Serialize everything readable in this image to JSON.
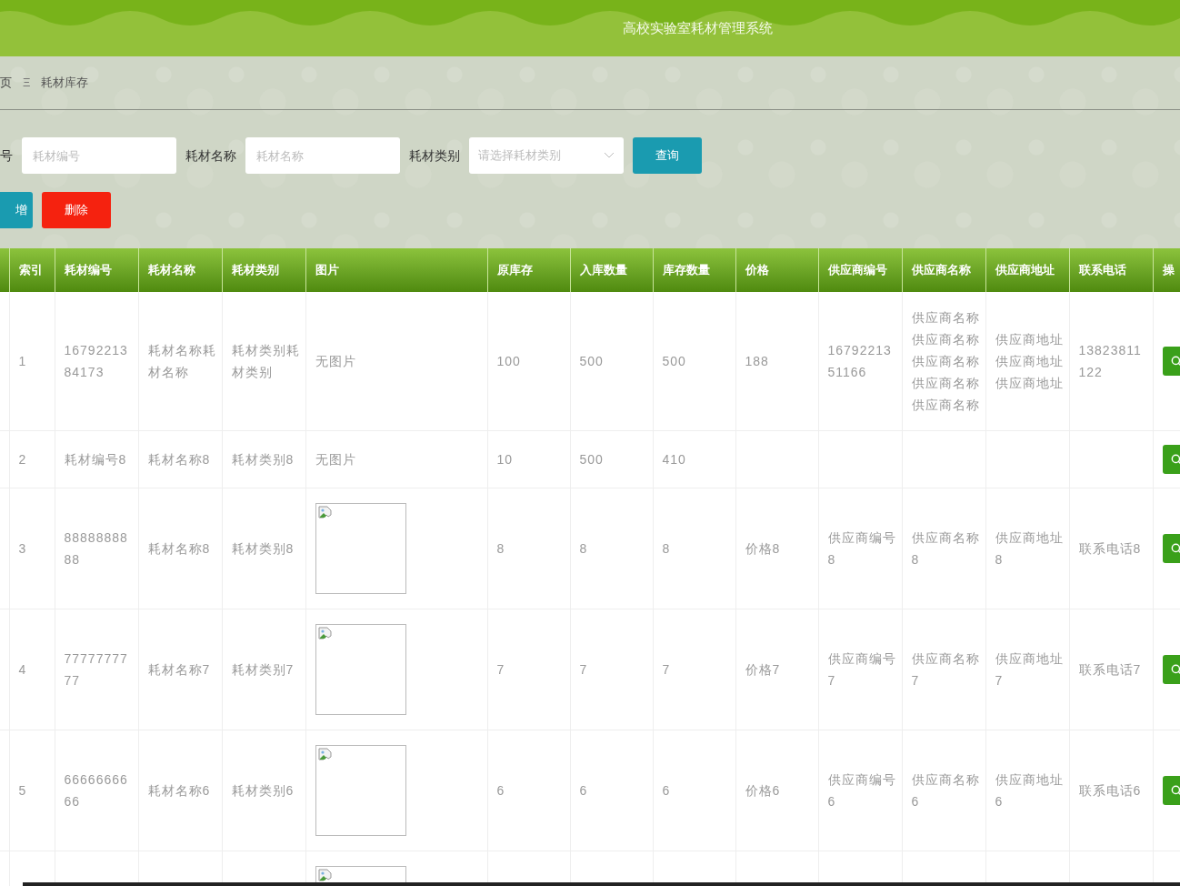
{
  "header": {
    "title": "高校实验室耗材管理系统"
  },
  "breadcrumb": {
    "items": [
      "页",
      "耗材库存"
    ],
    "separator": "Ξ"
  },
  "search": {
    "fields": [
      {
        "label": "号",
        "placeholder": "耗材编号",
        "kind": "input"
      },
      {
        "label": "耗材名称",
        "placeholder": "耗材名称",
        "kind": "input"
      },
      {
        "label": "耗材类别",
        "placeholder": "请选择耗材类别",
        "kind": "select"
      }
    ],
    "query_button": "查询"
  },
  "actions": [
    {
      "label": "增",
      "kind": "add"
    },
    {
      "label": "删除",
      "kind": "delete"
    }
  ],
  "table": {
    "columns": [
      "索引",
      "耗材编号",
      "耗材名称",
      "耗材类别",
      "图片",
      "原库存",
      "入库数量",
      "库存数量",
      "价格",
      "供应商编号",
      "供应商名称",
      "供应商地址",
      "联系电话",
      "操"
    ],
    "rows": [
      {
        "cells": [
          "1",
          "1679221384173",
          "耗材名称耗材名称",
          "耗材类别耗材类别",
          {
            "kind": "text",
            "text": "无图片"
          },
          "100",
          "500",
          "500",
          "188",
          "1679221351166",
          "供应商名称供应商名称供应商名称供应商名称供应商名称",
          "供应商地址供应商地址供应商地址",
          "13823811122"
        ],
        "action": true
      },
      {
        "cells": [
          "2",
          "耗材编号8",
          "耗材名称8",
          "耗材类别8",
          {
            "kind": "text",
            "text": "无图片"
          },
          "10",
          "500",
          "410",
          "",
          "",
          "",
          "",
          ""
        ],
        "action": true
      },
      {
        "cells": [
          "3",
          "8888888888",
          "耗材名称8",
          "耗材类别8",
          {
            "kind": "broken"
          },
          "8",
          "8",
          "8",
          "价格8",
          "供应商编号8",
          "供应商名称8",
          "供应商地址8",
          "联系电话8"
        ],
        "action": true
      },
      {
        "cells": [
          "4",
          "7777777777",
          "耗材名称7",
          "耗材类别7",
          {
            "kind": "broken"
          },
          "7",
          "7",
          "7",
          "价格7",
          "供应商编号7",
          "供应商名称7",
          "供应商地址7",
          "联系电话7"
        ],
        "action": true
      },
      {
        "cells": [
          "5",
          "6666666666",
          "耗材名称6",
          "耗材类别6",
          {
            "kind": "broken"
          },
          "6",
          "6",
          "6",
          "价格6",
          "供应商编号6",
          "供应商名称6",
          "供应商地址6",
          "联系电话6"
        ],
        "action": true
      },
      {
        "cells": [
          "",
          "",
          "",
          "",
          {
            "kind": "broken"
          },
          "",
          "",
          "",
          "",
          "",
          "",
          "",
          ""
        ]
      }
    ]
  }
}
